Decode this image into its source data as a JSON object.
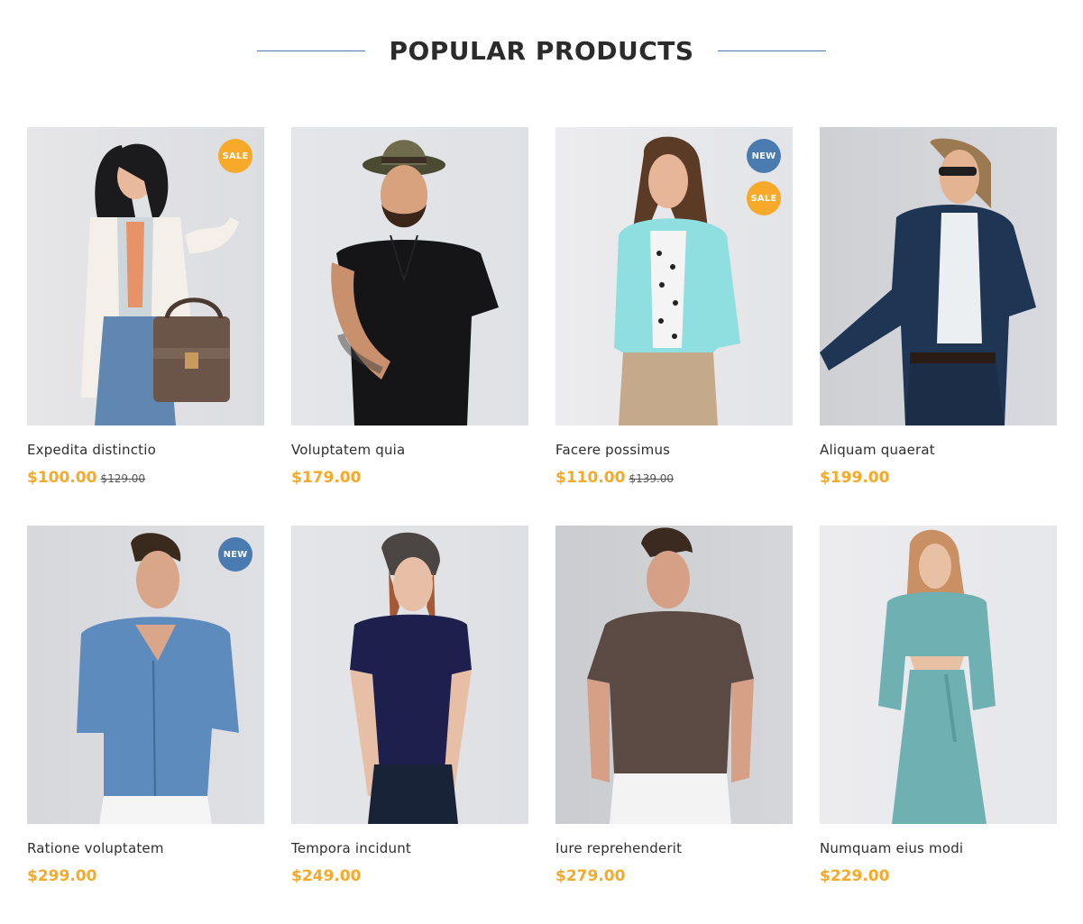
{
  "section": {
    "title": "POPULAR PRODUCTS"
  },
  "colors": {
    "accent": "#f7a929",
    "badge_new": "#4a7bb0",
    "divider": "#4a7bb0"
  },
  "products": [
    {
      "name": "Expedita distinctio",
      "price": "$100.00",
      "old_price": "$129.00",
      "badges": [
        "SALE"
      ],
      "image": "woman-white-coat-handbag"
    },
    {
      "name": "Voluptatem quia",
      "price": "$179.00",
      "old_price": "",
      "badges": [],
      "image": "man-hat-black-tshirt"
    },
    {
      "name": "Facere possimus",
      "price": "$110.00",
      "old_price": "$139.00",
      "badges": [
        "NEW",
        "SALE"
      ],
      "image": "woman-teal-jacket"
    },
    {
      "name": "Aliquam quaerat",
      "price": "$199.00",
      "old_price": "",
      "badges": [],
      "image": "man-navy-suit-sunglasses"
    },
    {
      "name": "Ratione voluptatem",
      "price": "$299.00",
      "old_price": "",
      "badges": [
        "NEW"
      ],
      "image": "man-denim-shirt"
    },
    {
      "name": "Tempora incidunt",
      "price": "$249.00",
      "old_price": "",
      "badges": [],
      "image": "woman-navy-tshirt"
    },
    {
      "name": "Iure reprehenderit",
      "price": "$279.00",
      "old_price": "",
      "badges": [],
      "image": "man-brown-tshirt"
    },
    {
      "name": "Numquam eius modi",
      "price": "$229.00",
      "old_price": "",
      "badges": [],
      "image": "woman-teal-dress"
    }
  ]
}
